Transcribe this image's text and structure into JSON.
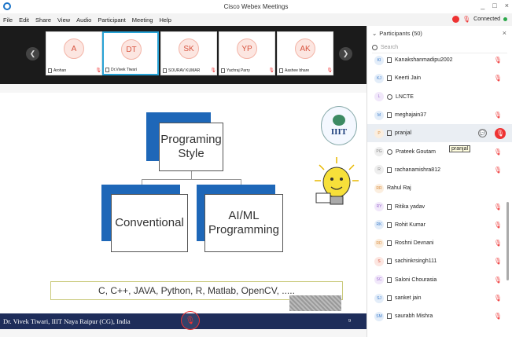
{
  "window": {
    "title": "Cisco Webex Meetings",
    "controls": [
      "_",
      "□",
      "×"
    ]
  },
  "menu": [
    "File",
    "Edit",
    "Share",
    "View",
    "Audio",
    "Participant",
    "Meeting",
    "Help"
  ],
  "status": {
    "connected": "Connected"
  },
  "video_strip": {
    "tiles": [
      {
        "initials": "A",
        "name": "Arohan"
      },
      {
        "initials": "DT",
        "name": "Dr.Vivek Tiwari"
      },
      {
        "initials": "SK",
        "name": "SOURAV KUMAR"
      },
      {
        "initials": "YP",
        "name": "Yachraj Parry"
      },
      {
        "initials": "AK",
        "name": "Aashee bhare"
      }
    ]
  },
  "slide": {
    "top_box": "Programing Style",
    "left_box": "Conventional",
    "right_box": "AI/ML Programming",
    "languages": "C, C++, JAVA, Python, R, Matlab, OpenCV, .....",
    "logo_text": "IIIT"
  },
  "footer": {
    "presenter": "Dr. Vivek Tiwari, IIIT Naya Raipur (CG), India",
    "page": "9"
  },
  "participants": {
    "title": "Participants (50)",
    "search_placeholder": "Search",
    "tooltip": "pranjal",
    "list": [
      {
        "initials": "KI",
        "name": "Kanakshanmadipu2002",
        "color": "#3f7fcc",
        "bg": "#e3edf9"
      },
      {
        "initials": "KJ",
        "name": "Keerti Jain",
        "color": "#3f7fcc",
        "bg": "#e3edf9"
      },
      {
        "initials": "L",
        "name": "LNCTE",
        "color": "#a06fd0",
        "bg": "#f1e8fa"
      },
      {
        "initials": "M",
        "name": "meghajain37",
        "color": "#3f7fcc",
        "bg": "#e3edf9"
      },
      {
        "initials": "P",
        "name": "pranjal",
        "color": "#d98c3c",
        "bg": "#fbeedf"
      },
      {
        "initials": "PG",
        "name": "Prateek Goutam",
        "color": "#888",
        "bg": "#eee"
      },
      {
        "initials": "R",
        "name": "rachanamishra812",
        "color": "#888",
        "bg": "#eee"
      },
      {
        "initials": "RR",
        "name": "Rahul Raj",
        "color": "#d98c3c",
        "bg": "#fbeedf"
      },
      {
        "initials": "RY",
        "name": "Ritika yadav",
        "color": "#a06fd0",
        "bg": "#f1e8fa"
      },
      {
        "initials": "RK",
        "name": "Rohit Kumar",
        "color": "#3f7fcc",
        "bg": "#e3edf9"
      },
      {
        "initials": "RD",
        "name": "Roshni Devnani",
        "color": "#d98c3c",
        "bg": "#fbeedf"
      },
      {
        "initials": "S",
        "name": "sachinkrsingh111",
        "color": "#d9543f",
        "bg": "#fce6e1"
      },
      {
        "initials": "SC",
        "name": "Saloni Chourasia",
        "color": "#a06fd0",
        "bg": "#f1e8fa"
      },
      {
        "initials": "SJ",
        "name": "sanket jain",
        "color": "#3f7fcc",
        "bg": "#e3edf9"
      },
      {
        "initials": "SM",
        "name": "saurabh Mishra",
        "color": "#3f7fcc",
        "bg": "#e3edf9"
      }
    ]
  }
}
